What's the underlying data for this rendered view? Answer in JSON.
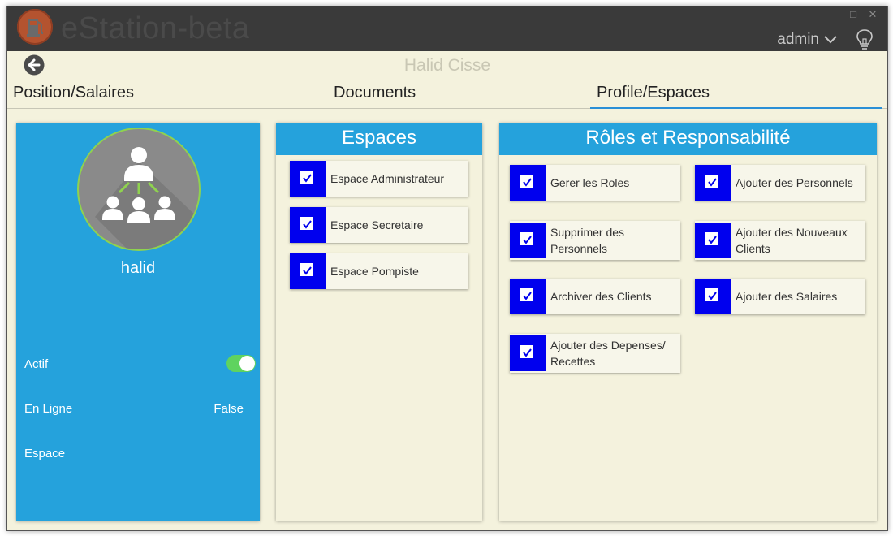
{
  "app": {
    "title": "eStation-beta",
    "user": "admin"
  },
  "window_controls": {
    "minimize": "–",
    "maximize": "□",
    "close": "✕"
  },
  "header": {
    "person_name": "Halid Cisse"
  },
  "tabs": [
    {
      "label": "Position/Salaires"
    },
    {
      "label": "Documents"
    },
    {
      "label": "Profile/Espaces",
      "active": true
    }
  ],
  "profile": {
    "username": "halid",
    "fields": [
      {
        "label": "Actif",
        "value": ""
      },
      {
        "label": "En Ligne",
        "value": "False"
      },
      {
        "label": "Espace",
        "value": ""
      }
    ],
    "actif_on": true
  },
  "espaces": {
    "title": "Espaces",
    "items": [
      {
        "label": "Espace Administrateur",
        "checked": true
      },
      {
        "label": "Espace Secretaire",
        "checked": true
      },
      {
        "label": "Espace Pompiste",
        "checked": true
      }
    ]
  },
  "roles": {
    "title": "Rôles et Responsabilité",
    "items": [
      {
        "label": "Gerer les Roles",
        "checked": true
      },
      {
        "label": "Ajouter des Personnels",
        "checked": true
      },
      {
        "label": "Supprimer des Personnels",
        "checked": true
      },
      {
        "label": "Ajouter des Nouveaux Clients",
        "checked": true
      },
      {
        "label": "Archiver des Clients",
        "checked": true
      },
      {
        "label": "Ajouter des Salaires",
        "checked": true
      },
      {
        "label": "Ajouter des Depenses/ Recettes",
        "checked": true
      }
    ]
  },
  "colors": {
    "accent": "#25a2dc",
    "checkbox": "#0000ee",
    "background": "#f4f2dd",
    "titlebar": "#3a3a3a",
    "toggle": "#5fd35f"
  }
}
